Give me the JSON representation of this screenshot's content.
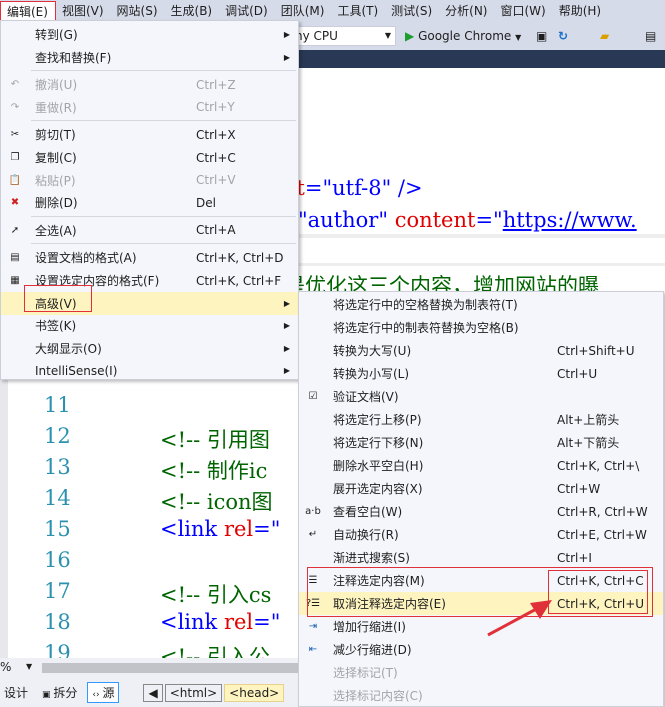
{
  "menubar": [
    "编辑(E)",
    "视图(V)",
    "网站(S)",
    "生成(B)",
    "调试(D)",
    "团队(M)",
    "工具(T)",
    "测试(S)",
    "分析(N)",
    "窗口(W)",
    "帮助(H)"
  ],
  "toolbar": {
    "cpu": "ny CPU",
    "browser": "Google Chrome"
  },
  "editor": {
    "line_a": {
      "attr": "et",
      "eq": "=",
      "val": "\"utf-8\"",
      "end": " />"
    },
    "line_b": {
      "val": "\"author\"",
      "attr": " content",
      "eq": "=\"",
      "link": "https://www."
    },
    "line_c": "是优化这三个内容，增加网站的曝",
    "lines": [
      {
        "n": "11",
        "parts": []
      },
      {
        "n": "12",
        "parts": [
          {
            "c": "cm",
            "t": "<!-- 引用图"
          }
        ]
      },
      {
        "n": "13",
        "parts": [
          {
            "c": "cm",
            "t": "<!-- 制作ic"
          }
        ]
      },
      {
        "n": "14",
        "parts": [
          {
            "c": "cm",
            "t": "<!-- icon图"
          }
        ]
      },
      {
        "n": "15",
        "parts": [
          {
            "c": "tg",
            "t": "<link"
          },
          {
            "c": "at",
            "t": " rel"
          },
          {
            "c": "tg",
            "t": "=\""
          }
        ]
      },
      {
        "n": "16",
        "parts": []
      },
      {
        "n": "17",
        "parts": [
          {
            "c": "cm",
            "t": "<!-- 引入cs"
          }
        ]
      },
      {
        "n": "18",
        "parts": [
          {
            "c": "tg",
            "t": "<link"
          },
          {
            "c": "at",
            "t": " rel"
          },
          {
            "c": "tg",
            "t": "=\""
          }
        ]
      },
      {
        "n": "19",
        "parts": [
          {
            "c": "cm",
            "t": "<!-- 引入公"
          }
        ]
      }
    ]
  },
  "status": {
    "zoom": "%",
    "design": "设计",
    "split": "拆分",
    "source": "源",
    "crumbs": [
      "<html>",
      "<head>"
    ]
  },
  "edit_menu": [
    {
      "label": "转到(G)",
      "sub": true
    },
    {
      "label": "查找和替换(F)",
      "sub": true
    },
    {
      "sep": true
    },
    {
      "label": "撤消(U)",
      "shortcut": "Ctrl+Z",
      "icon": "undo",
      "disabled": true
    },
    {
      "label": "重做(R)",
      "shortcut": "Ctrl+Y",
      "icon": "redo",
      "disabled": true
    },
    {
      "sep": true
    },
    {
      "label": "剪切(T)",
      "shortcut": "Ctrl+X",
      "icon": "cut"
    },
    {
      "label": "复制(C)",
      "shortcut": "Ctrl+C",
      "icon": "copy"
    },
    {
      "label": "粘贴(P)",
      "shortcut": "Ctrl+V",
      "icon": "paste",
      "disabled": true
    },
    {
      "label": "删除(D)",
      "shortcut": "Del",
      "icon": "delete"
    },
    {
      "sep": true
    },
    {
      "label": "全选(A)",
      "shortcut": "Ctrl+A",
      "icon": "select-all"
    },
    {
      "sep": true
    },
    {
      "label": "设置文档的格式(A)",
      "shortcut": "Ctrl+K, Ctrl+D",
      "icon": "format-document"
    },
    {
      "label": "设置选定内容的格式(F)",
      "shortcut": "Ctrl+K, Ctrl+F",
      "icon": "format-selection"
    },
    {
      "label": "高级(V)",
      "sub": true,
      "highlight": true
    },
    {
      "label": "书签(K)",
      "sub": true
    },
    {
      "label": "大纲显示(O)",
      "sub": true
    },
    {
      "label": "IntelliSense(I)",
      "sub": true
    }
  ],
  "advanced_menu": [
    {
      "label": "将选定行中的空格替换为制表符(T)"
    },
    {
      "label": "将选定行中的制表符替换为空格(B)"
    },
    {
      "label": "转换为大写(U)",
      "shortcut": "Ctrl+Shift+U"
    },
    {
      "label": "转换为小写(L)",
      "shortcut": "Ctrl+U"
    },
    {
      "label": "验证文档(V)",
      "icon": "validate"
    },
    {
      "label": "将选定行上移(P)",
      "shortcut": "Alt+上箭头"
    },
    {
      "label": "将选定行下移(N)",
      "shortcut": "Alt+下箭头"
    },
    {
      "label": "删除水平空白(H)",
      "shortcut": "Ctrl+K, Ctrl+\\"
    },
    {
      "label": "展开选定内容(X)",
      "shortcut": "Ctrl+W"
    },
    {
      "label": "查看空白(W)",
      "shortcut": "Ctrl+R, Ctrl+W",
      "icon": "view-whitespace"
    },
    {
      "label": "自动换行(R)",
      "shortcut": "Ctrl+E, Ctrl+W",
      "icon": "word-wrap"
    },
    {
      "label": "渐进式搜索(S)",
      "shortcut": "Ctrl+I"
    },
    {
      "label": "注释选定内容(M)",
      "shortcut": "Ctrl+K, Ctrl+C",
      "icon": "comment"
    },
    {
      "label": "取消注释选定内容(E)",
      "shortcut": "Ctrl+K, Ctrl+U",
      "icon": "uncomment",
      "highlight": true
    },
    {
      "label": "增加行缩进(I)",
      "icon": "indent"
    },
    {
      "label": "减少行缩进(D)",
      "icon": "outdent"
    },
    {
      "label": "选择标记(T)",
      "disabled": true
    },
    {
      "label": "选择标记内容(C)",
      "disabled": true
    }
  ],
  "colors": {
    "annotation": "#e0303a",
    "highlight": "#fdf4bf",
    "menubar": "#d6dbe9"
  }
}
